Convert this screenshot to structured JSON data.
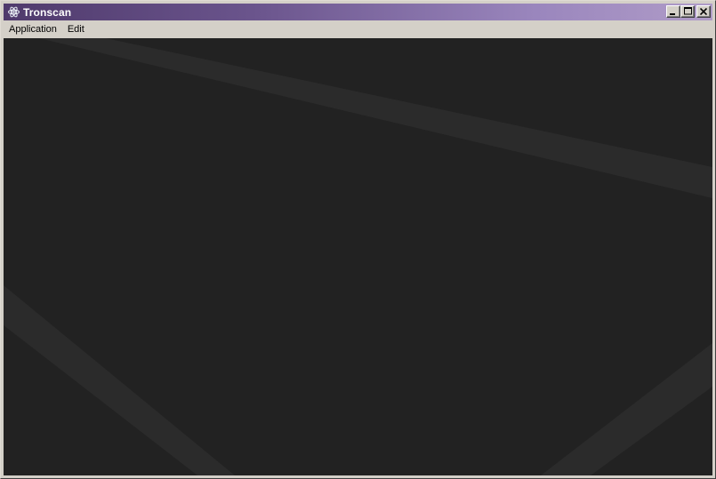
{
  "window": {
    "title": "Tronscan",
    "icon": "electron-atom-icon",
    "controls": {
      "minimize_icon": "minimize-icon",
      "maximize_icon": "maximize-icon",
      "close_icon": "close-icon"
    }
  },
  "menubar": {
    "items": [
      {
        "label": "Application"
      },
      {
        "label": "Edit"
      }
    ]
  },
  "colors": {
    "content_background": "#222222",
    "stripe": "#2b2b2b",
    "titlebar_start": "#4f3a6c",
    "titlebar_end": "#b09cc8",
    "chrome": "#d4d0c8"
  }
}
